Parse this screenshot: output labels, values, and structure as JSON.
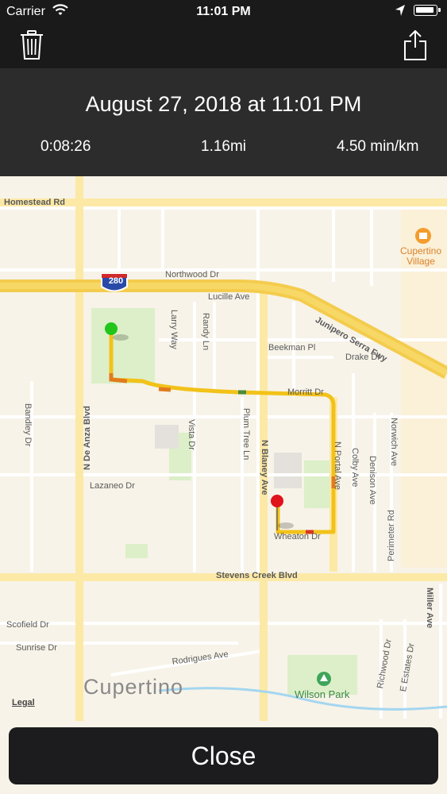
{
  "status_bar": {
    "carrier": "Carrier",
    "time": "11:01 PM",
    "wifi_icon": "wifi-icon",
    "location_icon": "location-arrow-icon",
    "battery_icon": "battery-icon"
  },
  "toolbar": {
    "delete_icon": "trash-icon",
    "share_icon": "share-icon"
  },
  "summary": {
    "date": "August 27, 2018 at 11:01 PM",
    "duration": "0:08:26",
    "distance": "1.16mi",
    "pace": "4.50 min/km"
  },
  "map": {
    "labels": {
      "homestead": "Homestead Rd",
      "northwood": "Northwood Dr",
      "lucille": "Lucille Ave",
      "junipero": "Junipero Serra Fwy",
      "cupertino_village": "Cupertino Village",
      "beekman": "Beekman Pl",
      "drake": "Drake Dr",
      "morritt": "Morritt Dr",
      "larry": "Larry Way",
      "randy": "Randy Ln",
      "n_de_anza": "N De Anza Blvd",
      "bandley": "Bandley Dr",
      "vista": "Vista Dr",
      "plum_tree": "Plum Tree Ln",
      "n_blaney": "N Blaney Ave",
      "n_portal": "N Portal Ave",
      "colby": "Colby Ave",
      "denison": "Denison Ave",
      "norwich": "Norwich Ave",
      "perimeter": "Perimeter Rd",
      "lazaneo": "Lazaneo Dr",
      "wheaton": "Wheaton Dr",
      "stevens_creek": "Stevens Creek Blvd",
      "scofield": "Scofield Dr",
      "sunrise": "Sunrise Dr",
      "rodrigues": "Rodrigues Ave",
      "richwood": "Richwood Dr",
      "e_estates": "E Estates Dr",
      "miller": "Miller Ave",
      "cupertino": "Cupertino",
      "wilson_park": "Wilson Park",
      "legal": "Legal",
      "highway": "280"
    },
    "start_pin_color": "#22c51a",
    "end_pin_color": "#e0121b",
    "route_color": "#f2c219"
  },
  "close_label": "Close"
}
